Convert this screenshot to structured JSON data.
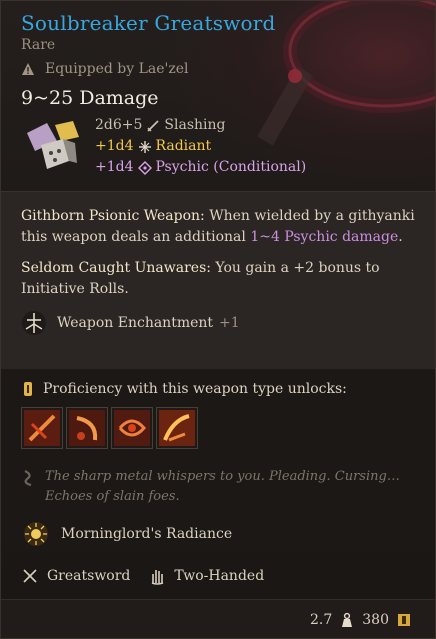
{
  "item": {
    "name": "Soulbreaker Greatsword",
    "rarity": "Rare",
    "equipped": "Equipped by Lae'zel",
    "damage": "9~25 Damage"
  },
  "damage_lines": {
    "base_dice": "2d6+5",
    "base_type": "Slashing",
    "radiant_dice": "+1d4",
    "radiant_type": "Radiant",
    "psychic_dice": "+1d4",
    "psychic_type": "Psychic (Conditional)"
  },
  "description": {
    "p1_title": "Githborn Psionic Weapon:",
    "p1_text": " When wielded by a githyanki this weapon deals an additional ",
    "p1_highlight": "1~4 Psychic damage",
    "p1_end": ".",
    "p2_title": "Seldom Caught Unawares:",
    "p2_text": " You gain a +2 bonus to Initiative Rolls."
  },
  "enchantment": {
    "label": "Weapon Enchantment",
    "value": "+1"
  },
  "proficiency": {
    "header": "Proficiency with this weapon type unlocks:",
    "actions": [
      "cleave-action-icon",
      "lacerate-action-icon",
      "rush-attack-icon",
      "prepare-action-icon"
    ]
  },
  "flavor": "The sharp metal whispers to you. Pleading. Cursing… Echoes of slain foes.",
  "passive": "Morninglord's Radiance",
  "properties": {
    "type": "Greatsword",
    "handed": "Two-Handed"
  },
  "footer": {
    "weight": "2.7",
    "value": "380"
  },
  "colors": {
    "name": "#35a8e0",
    "radiant": "#f3c84a",
    "psychic": "#d7a3e9"
  }
}
